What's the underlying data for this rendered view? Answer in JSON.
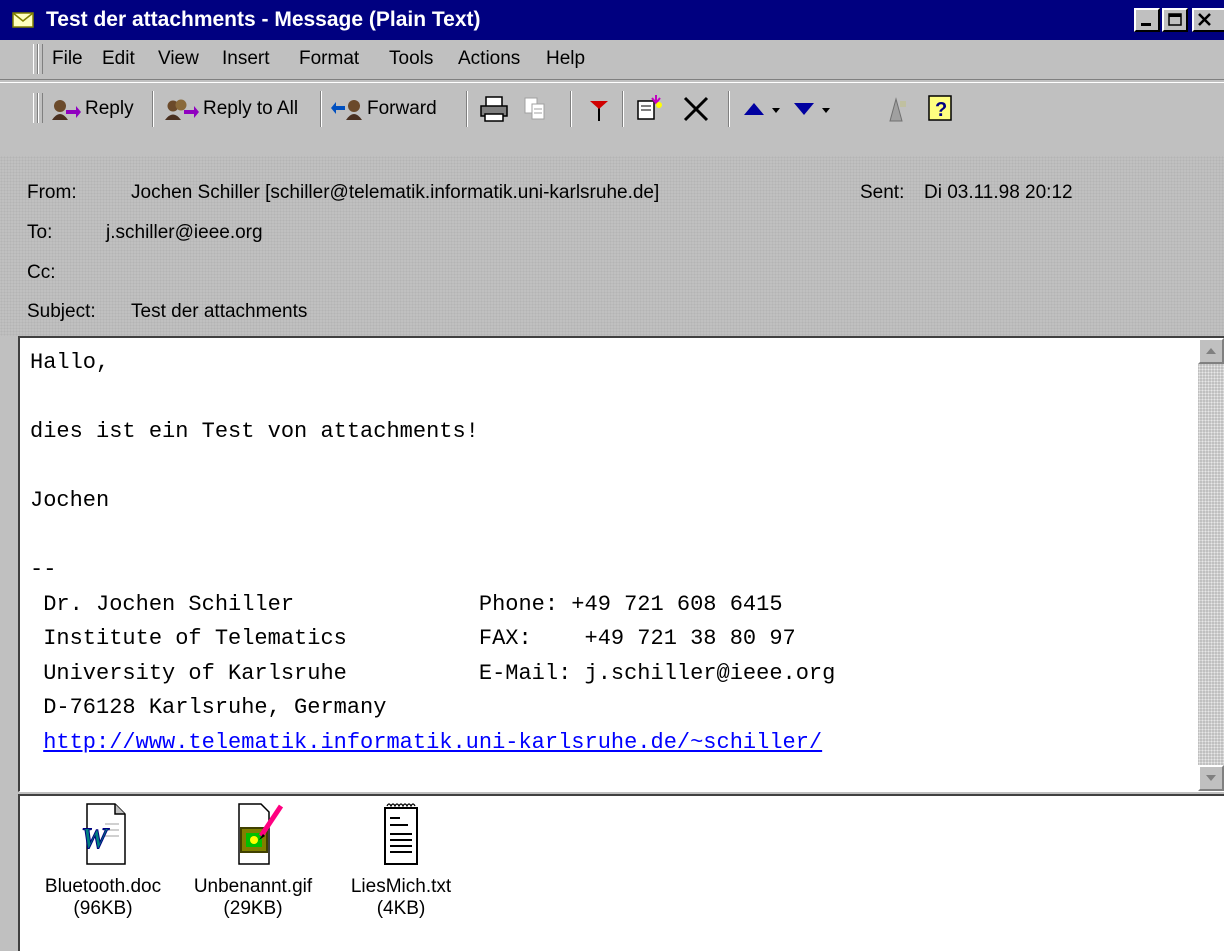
{
  "window": {
    "title": "Test der attachments - Message (Plain Text)",
    "icon": "envelope-icon",
    "controls": [
      "minimize-icon",
      "maximize-icon",
      "close-icon"
    ]
  },
  "menu": [
    "File",
    "Edit",
    "View",
    "Insert",
    "Format",
    "Tools",
    "Actions",
    "Help"
  ],
  "toolbar": {
    "reply": "Reply",
    "reply_all": "Reply to All",
    "forward": "Forward",
    "icons": [
      "print-icon",
      "copy-icon",
      "flag-icon",
      "move-to-folder-icon",
      "delete-icon",
      "previous-item-icon",
      "next-item-icon",
      "address-book-icon",
      "help-icon"
    ]
  },
  "header": {
    "from_label": "From:",
    "from_value": "Jochen Schiller [schiller@telematik.informatik.uni-karlsruhe.de]",
    "sent_label": "Sent:",
    "sent_value": "Di 03.11.98 20:12",
    "to_label": "To:",
    "to_value": "j.schiller@ieee.org",
    "cc_label": "Cc:",
    "cc_value": "",
    "subject_label": "Subject:",
    "subject_value": "Test der attachments"
  },
  "body": {
    "lines": [
      "Hallo,",
      "",
      "dies ist ein Test von attachments!",
      "",
      "Jochen",
      "",
      "--",
      " Dr. Jochen Schiller              Phone: +49 721 608 6415",
      " Institute of Telematics          FAX:    +49 721 38 80 97",
      " University of Karlsruhe          E-Mail: j.schiller@ieee.org",
      " D-76128 Karlsruhe, Germany"
    ],
    "link": "http://www.telematik.informatik.uni-karlsruhe.de/~schiller/"
  },
  "attachments": [
    {
      "name": "Bluetooth.doc",
      "size": "(96KB)",
      "icon": "word-document-icon"
    },
    {
      "name": "Unbenannt.gif",
      "size": "(29KB)",
      "icon": "image-file-icon"
    },
    {
      "name": "LiesMich.txt",
      "size": "(4KB)",
      "icon": "text-file-icon"
    }
  ]
}
